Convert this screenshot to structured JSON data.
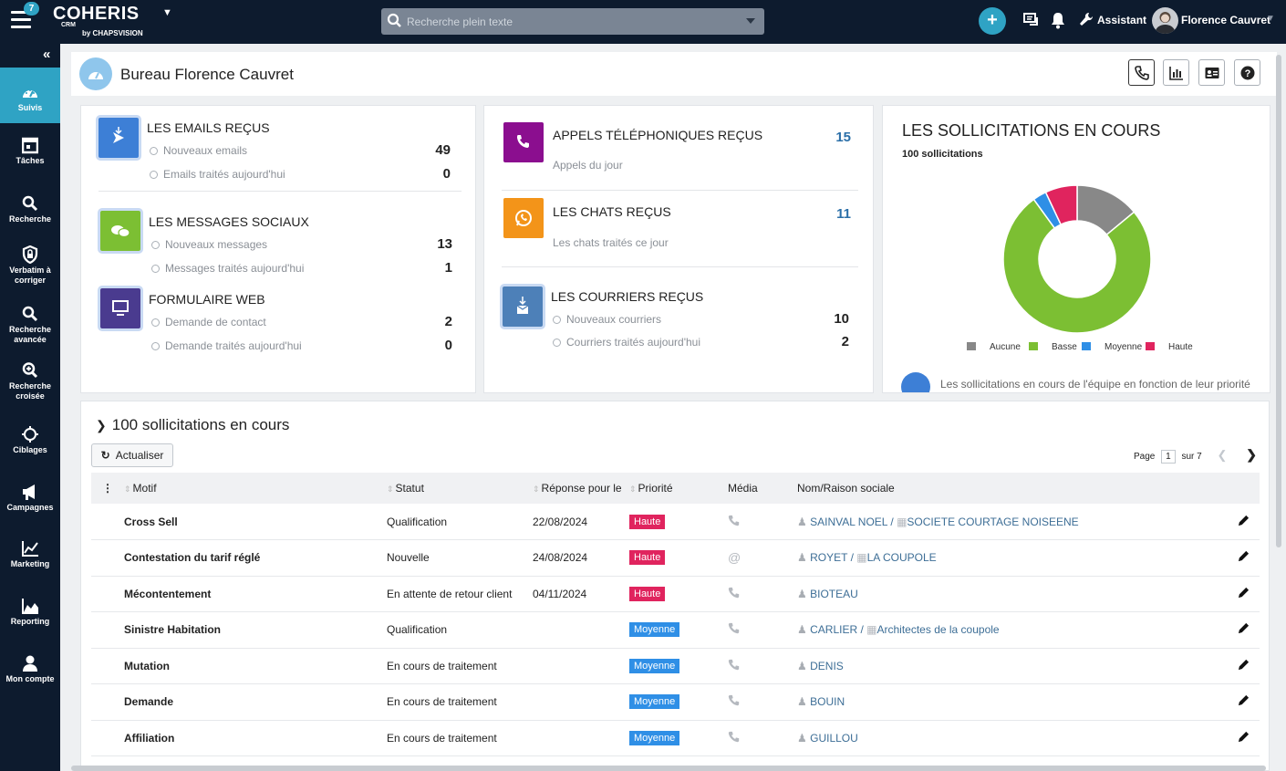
{
  "topbar": {
    "notification_count": "7",
    "logo_main": "COHERIS",
    "logo_crm": "CRM",
    "logo_by": "by CHAPSVISION",
    "search_placeholder": "Recherche plein texte",
    "assistant_label": "Assistant",
    "user_name": "Florence Cauvret"
  },
  "sidebar": {
    "items": [
      {
        "label": "Suivis",
        "icon": "gauge-icon"
      },
      {
        "label": "Tâches",
        "icon": "calendar-icon"
      },
      {
        "label": "Recherche",
        "icon": "search-icon"
      },
      {
        "label": "Verbatim à corriger",
        "icon": "shield-lock-icon"
      },
      {
        "label": "Recherche avancée",
        "icon": "search-icon"
      },
      {
        "label": "Recherche croisée",
        "icon": "zoom-plus-icon"
      },
      {
        "label": "Ciblages",
        "icon": "target-icon"
      },
      {
        "label": "Campagnes",
        "icon": "megaphone-icon"
      },
      {
        "label": "Marketing",
        "icon": "line-chart-icon"
      },
      {
        "label": "Reporting",
        "icon": "area-chart-icon"
      },
      {
        "label": "Mon compte",
        "icon": "user-icon"
      }
    ]
  },
  "header": {
    "title": "Bureau Florence Cauvret"
  },
  "card1": {
    "emails": {
      "title": "LES EMAILS REÇUS",
      "rows": [
        {
          "label": "Nouveaux emails",
          "value": "49"
        },
        {
          "label": "Emails traités aujourd'hui",
          "value": "0"
        }
      ]
    },
    "social": {
      "title": "LES MESSAGES SOCIAUX",
      "rows": [
        {
          "label": "Nouveaux messages",
          "value": "13"
        },
        {
          "label": "Messages traités aujourd'hui",
          "value": "1"
        }
      ]
    },
    "web": {
      "title": "FORMULAIRE WEB",
      "rows": [
        {
          "label": "Demande de contact",
          "value": "2"
        },
        {
          "label": "Demande traités aujourd'hui",
          "value": "0"
        }
      ]
    }
  },
  "card2": {
    "calls": {
      "title": "APPELS TÉLÉPHONIQUES REÇUS",
      "sub": "Appels du jour",
      "value": "15"
    },
    "chats": {
      "title": "LES CHATS REÇUS",
      "sub": "Les chats traités ce jour",
      "value": "11"
    },
    "mail": {
      "title": "LES COURRIERS REÇUS",
      "rows": [
        {
          "label": "Nouveaux courriers",
          "value": "10"
        },
        {
          "label": "Courriers traités aujourd'hui",
          "value": "2"
        }
      ]
    }
  },
  "card3": {
    "title": "LES SOLLICITATIONS EN COURS",
    "subtitle": "100 sollicitations",
    "footer": "Les sollicitations en cours de l'équipe en fonction de leur priorité"
  },
  "chart_data": {
    "type": "pie",
    "title": "LES SOLLICITATIONS EN COURS",
    "donut": true,
    "legend_position": "bottom",
    "categories": [
      "Aucune",
      "Basse",
      "Moyenne",
      "Haute"
    ],
    "values": [
      14,
      76,
      3,
      7
    ],
    "colors": [
      "#888888",
      "#7cbf33",
      "#2f8fe6",
      "#e0245e"
    ]
  },
  "table_panel": {
    "title": "100 sollicitations en cours",
    "refresh_label": "Actualiser",
    "page_label": "Page",
    "page_value": "1",
    "page_total": "sur 7",
    "columns": [
      "Motif",
      "Statut",
      "Réponse pour le",
      "Priorité",
      "Média",
      "Nom/Raison sociale"
    ],
    "rows": [
      {
        "motif": "Cross Sell",
        "statut": "Qualification",
        "date": "22/08/2024",
        "priorite": "Haute",
        "media": "phone-icon",
        "person": "SAINVAL NOEL",
        "company": "SOCIETE COURTAGE NOISEENE"
      },
      {
        "motif": "Contestation du tarif réglé",
        "statut": "Nouvelle",
        "date": "24/08/2024",
        "priorite": "Haute",
        "media": "at-icon",
        "person": "ROYET",
        "company": "LA COUPOLE"
      },
      {
        "motif": "Mécontentement",
        "statut": "En attente de retour client",
        "date": "04/11/2024",
        "priorite": "Haute",
        "media": "phone-icon",
        "person": "BIOTEAU",
        "company": ""
      },
      {
        "motif": "Sinistre Habitation",
        "statut": "Qualification",
        "date": "",
        "priorite": "Moyenne",
        "media": "phone-icon",
        "person": "CARLIER",
        "company": "Architectes de la coupole"
      },
      {
        "motif": "Mutation",
        "statut": "En cours de traitement",
        "date": "",
        "priorite": "Moyenne",
        "media": "phone-icon",
        "person": "DENIS",
        "company": ""
      },
      {
        "motif": "Demande",
        "statut": "En cours de traitement",
        "date": "",
        "priorite": "Moyenne",
        "media": "phone-icon",
        "person": "BOUIN",
        "company": ""
      },
      {
        "motif": "Affiliation",
        "statut": "En cours de traitement",
        "date": "",
        "priorite": "Moyenne",
        "media": "phone-icon",
        "person": "GUILLOU",
        "company": ""
      }
    ]
  }
}
